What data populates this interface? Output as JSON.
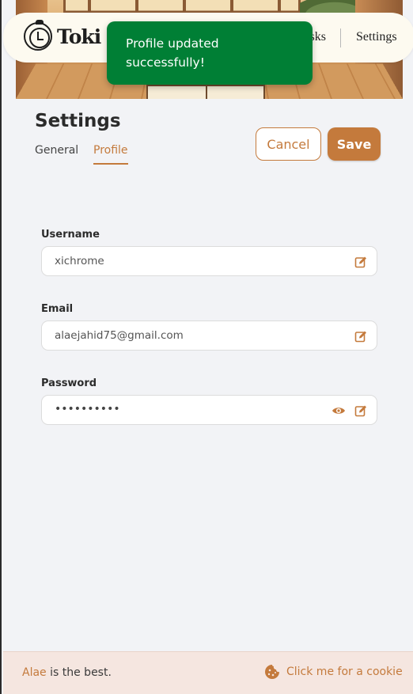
{
  "app": {
    "brand": "Toki"
  },
  "nav": {
    "partial_link": "Tasks",
    "settings_link": "Settings"
  },
  "toast": {
    "message": "Profile updated successfully!",
    "color": "#007f35"
  },
  "page": {
    "title": "Settings",
    "tabs": [
      {
        "label": "General",
        "active": false
      },
      {
        "label": "Profile",
        "active": true
      }
    ],
    "cancel_label": "Cancel",
    "save_label": "Save",
    "accent_color": "#c47a3c"
  },
  "form": {
    "username": {
      "label": "Username",
      "value": "xichrome",
      "icon": "edit-icon"
    },
    "email": {
      "label": "Email",
      "value": "alaejahid75@gmail.com",
      "icon": "edit-icon"
    },
    "password": {
      "label": "Password",
      "value": "••••••••••",
      "icons": [
        "eye-icon",
        "edit-icon"
      ]
    }
  },
  "footer": {
    "name": "Alae",
    "tagline": " is the best.",
    "cookie_label": "Click me for a cookie",
    "cookie_icon": "cookie-icon"
  }
}
